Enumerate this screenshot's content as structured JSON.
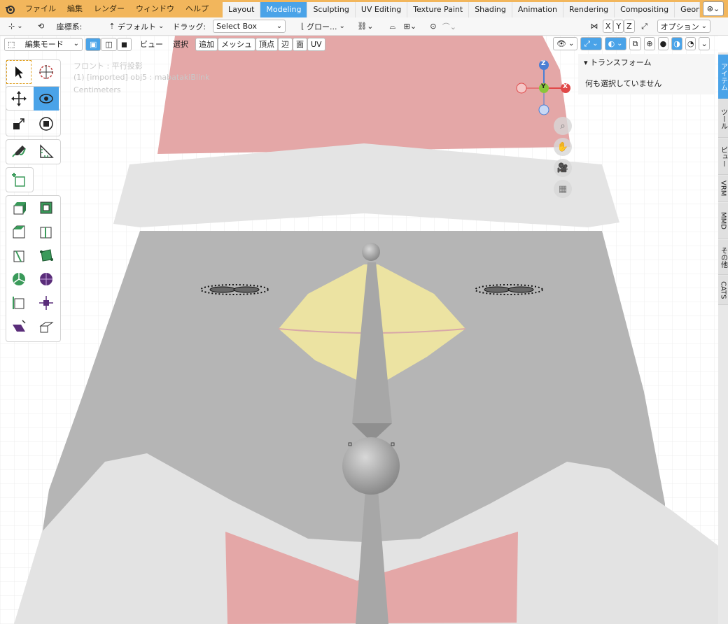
{
  "menubar": {
    "items": [
      "ファイル",
      "編集",
      "レンダー",
      "ウィンドウ",
      "ヘルプ"
    ]
  },
  "workspaces": [
    "Layout",
    "Modeling",
    "Sculpting",
    "UV Editing",
    "Texture Paint",
    "Shading",
    "Animation",
    "Rendering",
    "Compositing",
    "Geometry"
  ],
  "active_workspace": "Modeling",
  "toolheader": {
    "orientation_label": "座標系:",
    "orientation_value": "デフォルト",
    "drag_label": "ドラッグ:",
    "drag_value": "Select Box",
    "transform_value": "グロー...",
    "axis_x": "X",
    "axis_y": "Y",
    "axis_z": "Z",
    "options": "オプション"
  },
  "header": {
    "mode": "編集モード",
    "menus": [
      "ビュー",
      "選択",
      "追加",
      "メッシュ",
      "頂点",
      "辺",
      "面",
      "UV"
    ]
  },
  "viewport_overlay": {
    "view_name": "フロント : 平行投影",
    "object_info": "(1) [imported] obj5 : mabatakiBlink",
    "units": "Centimeters"
  },
  "gizmo": {
    "z": "Z",
    "y": "Y",
    "x": "X"
  },
  "npanel": {
    "section_title": "トランスフォーム",
    "message": "何も選択していません"
  },
  "side_tabs": [
    "アイテム",
    "ツール",
    "ビュー",
    "VRM",
    "MMD",
    "その他",
    "CATS"
  ],
  "colors": {
    "accent": "#4aa3e8",
    "topbar": "#f2b65c",
    "hat_red": "#e4a7a7",
    "face_gray": "#b5b5b5",
    "beak_yellow": "#ece3a2"
  }
}
